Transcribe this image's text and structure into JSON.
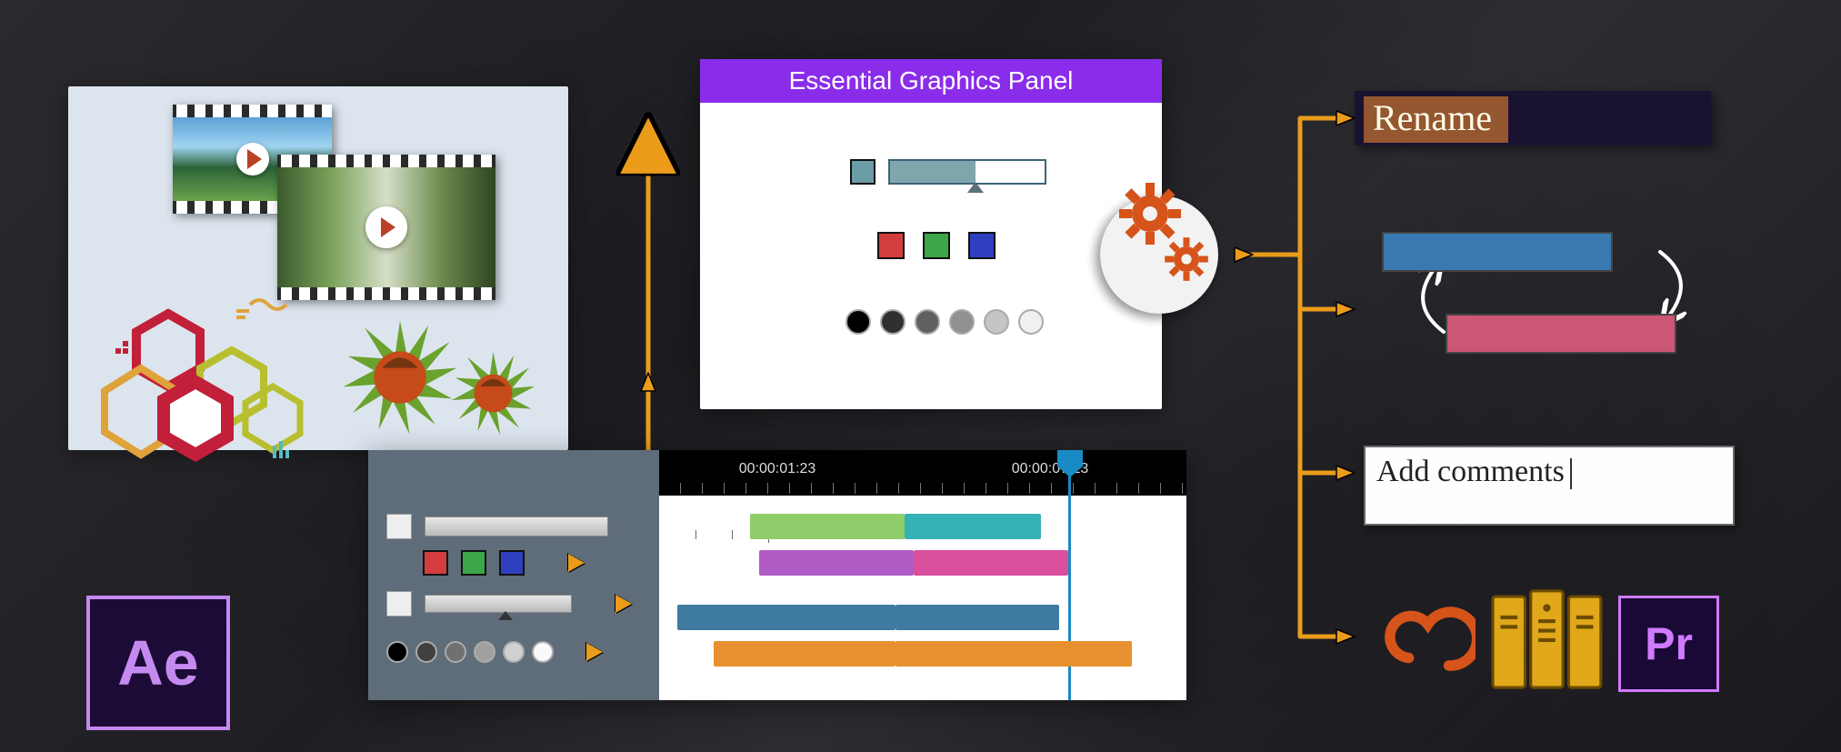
{
  "egp": {
    "title": "Essential Graphics Panel"
  },
  "timeline": {
    "t1": "00:00:01:23",
    "t2": "00:00:07:23"
  },
  "right": {
    "rename": "Rename",
    "comments": "Add comments"
  },
  "icons": {
    "ae": "Ae",
    "pr": "Pr"
  },
  "colors": {
    "orange": "#eb9c1a",
    "purple": "#8a2deb",
    "sw_teal": "#6a9da5",
    "sw_red": "#d43d3d",
    "sw_green": "#3da648",
    "sw_blue": "#2e3fbf",
    "track_blue": "#3f7aa3",
    "track_green": "#8fcd6a",
    "track_pink": "#da68c1",
    "track_teal": "#35b2b5",
    "track_purple": "#b15cc6",
    "track_orange": "#e8902f",
    "bar_blue": "#3979b2",
    "bar_red": "#cb5676"
  }
}
